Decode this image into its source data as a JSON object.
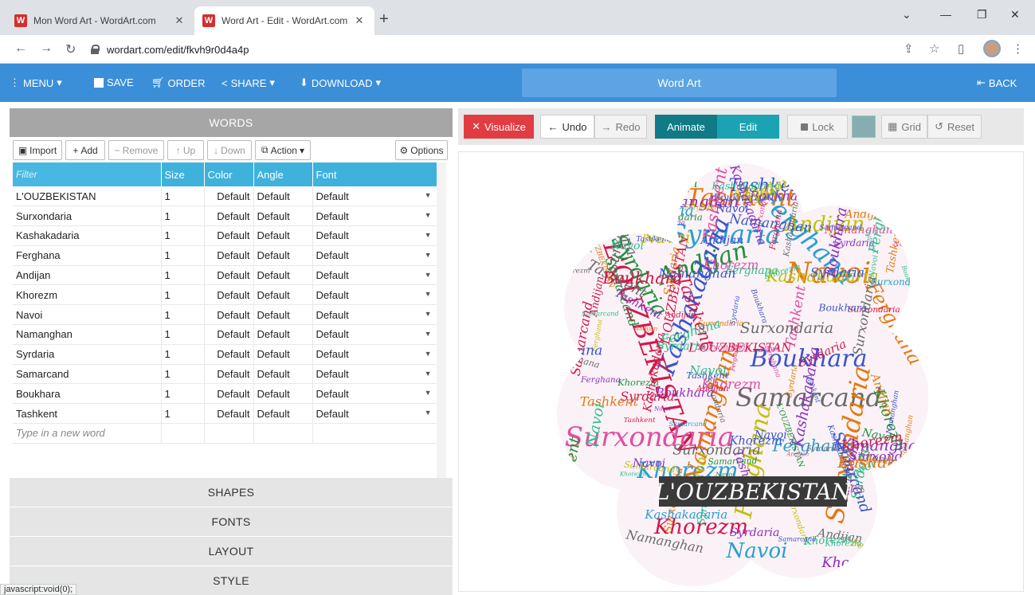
{
  "browser": {
    "tabs": [
      {
        "title": "Mon Word Art - WordArt.com",
        "favicon": "W"
      },
      {
        "title": "Word Art - Edit - WordArt.com",
        "favicon": "W"
      }
    ],
    "url": "wordart.com/edit/fkvh9r0d4a4p",
    "status_text": "javascript:void(0);"
  },
  "toolbar": {
    "menu": "MENU",
    "save": "SAVE",
    "order": "ORDER",
    "share": "SHARE",
    "download": "DOWNLOAD",
    "title": "Word Art",
    "back": "BACK"
  },
  "words_panel": {
    "title": "WORDS",
    "buttons": {
      "import": "Import",
      "add": "Add",
      "remove": "Remove",
      "up": "Up",
      "down": "Down",
      "action": "Action",
      "options": "Options"
    },
    "columns": {
      "filter": "Filter",
      "size": "Size",
      "color": "Color",
      "angle": "Angle",
      "font": "Font"
    },
    "rows": [
      {
        "word": "L'OUZBEKISTAN",
        "size": "1",
        "color": "Default",
        "angle": "Default",
        "font": "Default"
      },
      {
        "word": "Surxondaria",
        "size": "1",
        "color": "Default",
        "angle": "Default",
        "font": "Default"
      },
      {
        "word": "Kashakadaria",
        "size": "1",
        "color": "Default",
        "angle": "Default",
        "font": "Default"
      },
      {
        "word": "Ferghana",
        "size": "1",
        "color": "Default",
        "angle": "Default",
        "font": "Default"
      },
      {
        "word": "Andijan",
        "size": "1",
        "color": "Default",
        "angle": "Default",
        "font": "Default"
      },
      {
        "word": "Khorezm",
        "size": "1",
        "color": "Default",
        "angle": "Default",
        "font": "Default"
      },
      {
        "word": "Navoi",
        "size": "1",
        "color": "Default",
        "angle": "Default",
        "font": "Default"
      },
      {
        "word": "Namanghan",
        "size": "1",
        "color": "Default",
        "angle": "Default",
        "font": "Default"
      },
      {
        "word": "Syrdaria",
        "size": "1",
        "color": "Default",
        "angle": "Default",
        "font": "Default"
      },
      {
        "word": "Samarcand",
        "size": "1",
        "color": "Default",
        "angle": "Default",
        "font": "Default"
      },
      {
        "word": "Boukhara",
        "size": "1",
        "color": "Default",
        "angle": "Default",
        "font": "Default"
      },
      {
        "word": "Tashkent",
        "size": "1",
        "color": "Default",
        "angle": "Default",
        "font": "Default"
      }
    ],
    "new_word_placeholder": "Type in a new word"
  },
  "sections": {
    "shapes": "SHAPES",
    "fonts": "FONTS",
    "layout": "LAYOUT",
    "style": "STYLE"
  },
  "right_toolbar": {
    "visualize": "Visualize",
    "undo": "Undo",
    "redo": "Redo",
    "animate": "Animate",
    "edit": "Edit",
    "lock": "Lock",
    "grid": "Grid",
    "reset": "Reset"
  },
  "cloud": {
    "highlight": "L'OUZBEKISTAN",
    "words": [
      "Tashkent",
      "Syrdaria",
      "Andijan",
      "Kashakadaria",
      "Navoi",
      "Ferghana",
      "L'OUZBEKISTAN",
      "Surxondaria",
      "Khorezm",
      "Namanghan",
      "Boukhara",
      "Samarcand",
      "Ferghana",
      "Khorezm",
      "Surxondaria",
      "Tashkent",
      "Andijan",
      "Syrdaria",
      "Navoi",
      "Ferghana",
      "Andijan",
      "Tashkent",
      "Navoi",
      "Boukhara",
      "Namanghan",
      "Khorezm",
      "Kashakadaria",
      "Samarcand",
      "Syrdaria",
      "Surxondaria"
    ],
    "colors": [
      "#d2184a",
      "#1f8f3a",
      "#3a55c8",
      "#8c2fbf",
      "#e07a10",
      "#2a9fd0",
      "#c0c010",
      "#6a6a6a",
      "#e04fa0",
      "#2fbf8c"
    ]
  },
  "colors": {
    "accent": "#3b8fd9",
    "visualize": "#e23c43",
    "animate": "#107a86",
    "edit": "#1ba3b3"
  }
}
